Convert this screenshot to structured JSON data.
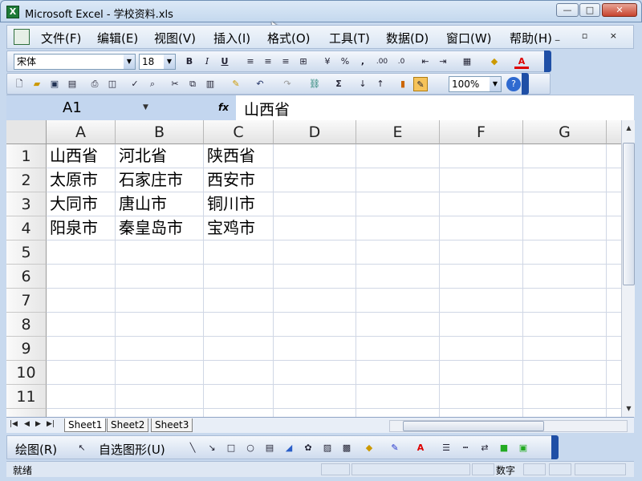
{
  "window": {
    "title": "Microsoft Excel - 学校资料.xls",
    "app_icon": "X",
    "min": "—",
    "max": "□",
    "close": "✕"
  },
  "menu": [
    "文件(F)",
    "编辑(E)",
    "视图(V)",
    "插入(I)",
    "格式(O)",
    "工具(T)",
    "数据(D)",
    "窗口(W)",
    "帮助(H)"
  ],
  "doc_controls": "_ ▫ ×",
  "format_toolbar": {
    "font": "宋体",
    "size": "18",
    "bold": "B",
    "italic": "I",
    "underline": "U",
    "percent": "%",
    "comma": ",",
    "inc_dec": ".00",
    "dec_dec": ".0",
    "font_color": "A"
  },
  "standard_toolbar": {
    "zoom": "100%",
    "sum": "Σ"
  },
  "formula_bar": {
    "name_box": "A1",
    "fx": "fx",
    "value": "山西省"
  },
  "columns": [
    "A",
    "B",
    "C",
    "D",
    "E",
    "F",
    "G"
  ],
  "rows": [
    "1",
    "2",
    "3",
    "4",
    "5",
    "6",
    "7",
    "8",
    "9",
    "10",
    "11"
  ],
  "cells": [
    [
      "山西省",
      "河北省",
      "陕西省"
    ],
    [
      "太原市",
      "石家庄市",
      "西安市"
    ],
    [
      "大同市",
      "唐山市",
      "铜川市"
    ],
    [
      "阳泉市",
      "秦皇岛市",
      "宝鸡市"
    ]
  ],
  "sheet_tabs": [
    "Sheet1",
    "Sheet2",
    "Sheet3"
  ],
  "draw_toolbar": {
    "draw": "绘图(R)",
    "autoshapes": "自选图形(U)"
  },
  "status": {
    "text": "就绪",
    "num": "数字"
  }
}
